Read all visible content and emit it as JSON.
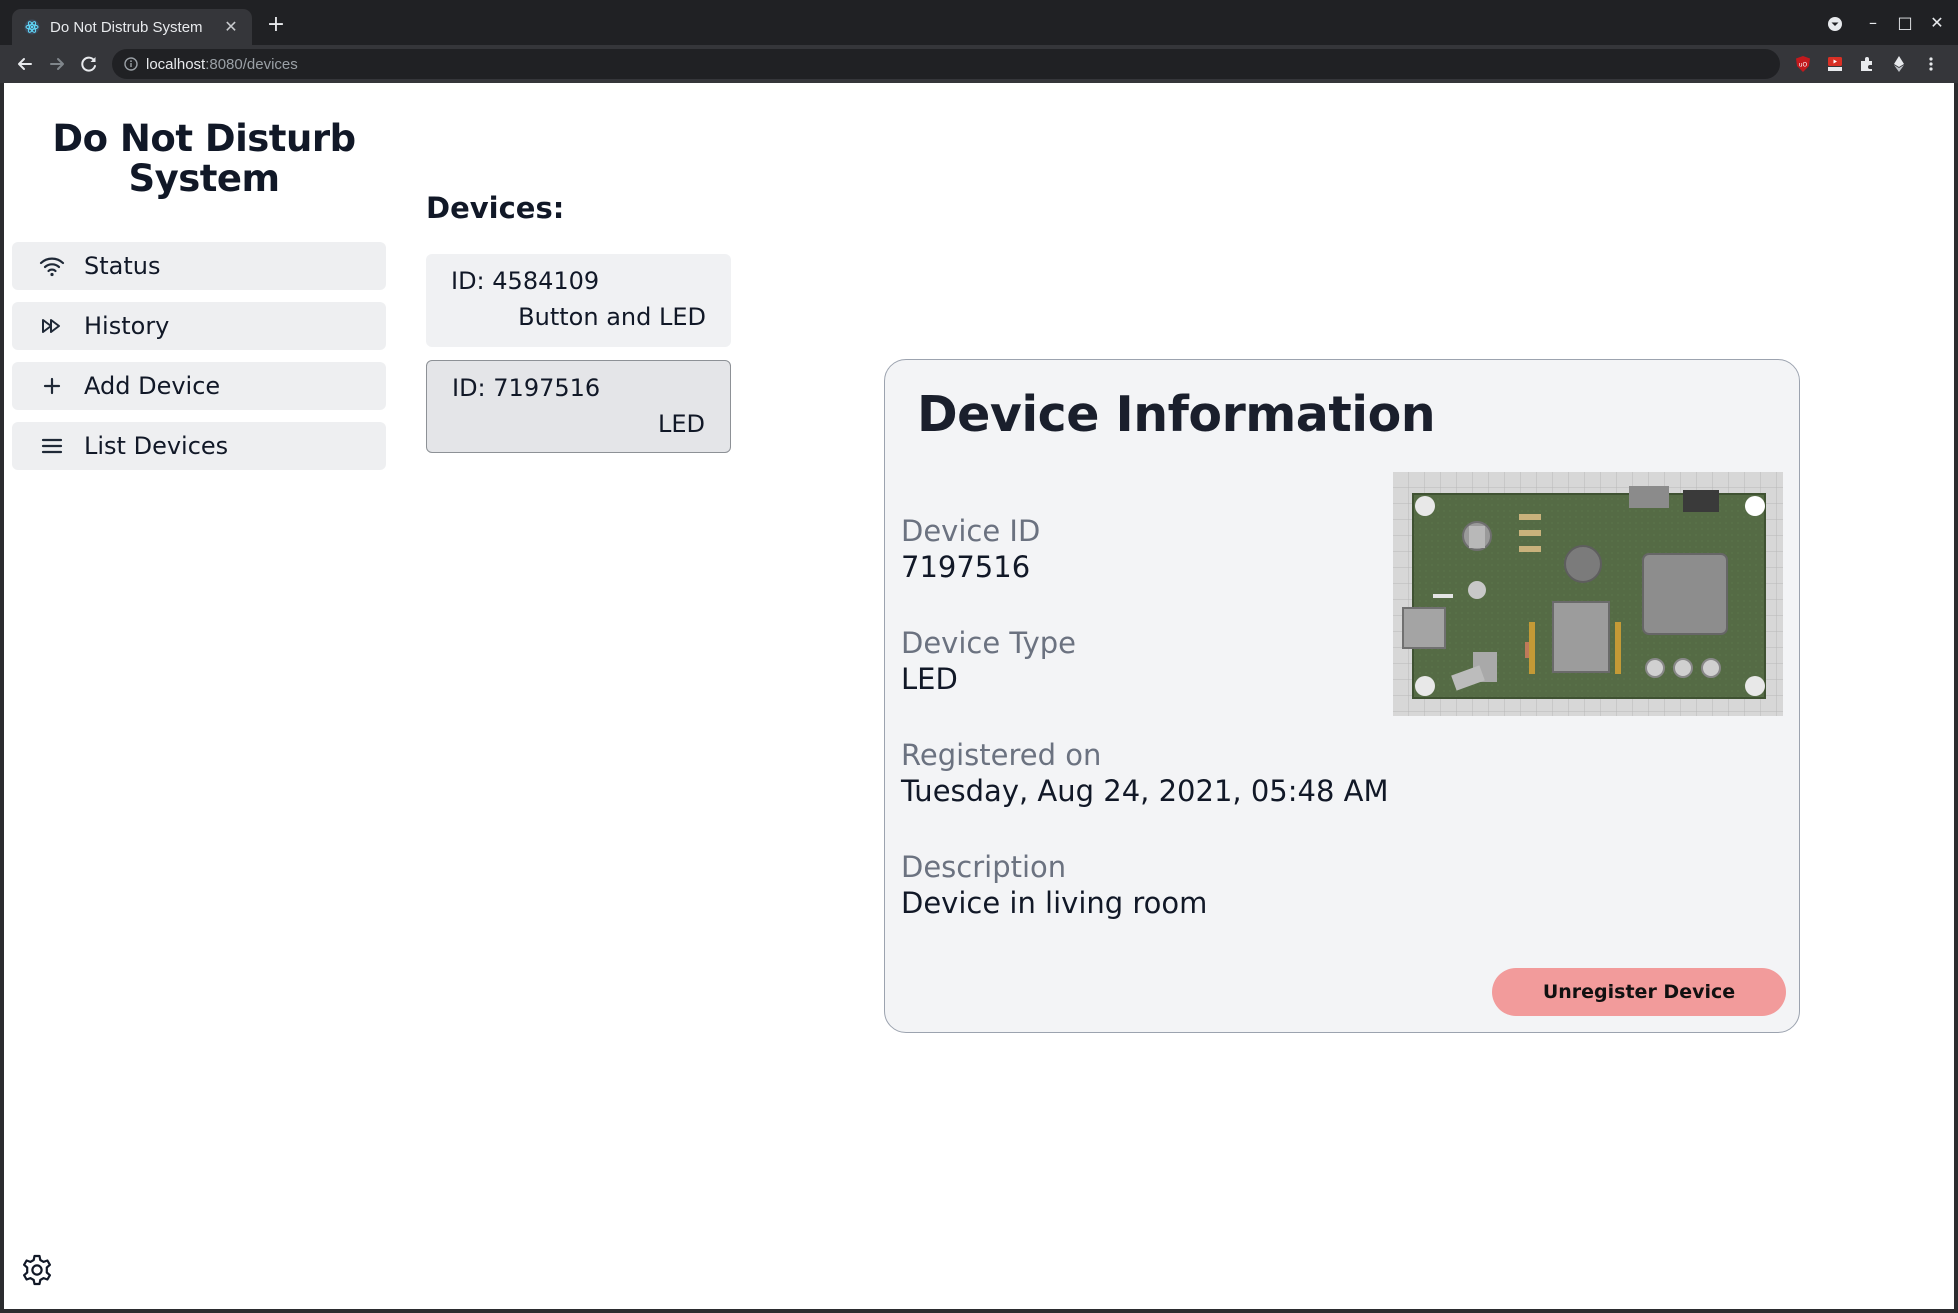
{
  "browser": {
    "tab_title": "Do Not Distrub System",
    "tab_close": "✕",
    "new_tab": "+",
    "url_host": "localhost",
    "url_path": ":8080/devices",
    "window_controls": {
      "minimize": "–",
      "maximize": "□",
      "close": "✕"
    }
  },
  "sidebar": {
    "title": "Do Not Disturb System",
    "items": [
      {
        "label": "Status",
        "icon": "wifi-icon"
      },
      {
        "label": "History",
        "icon": "fast-forward-icon"
      },
      {
        "label": "Add Device",
        "icon": "plus-icon"
      },
      {
        "label": "List Devices",
        "icon": "list-icon"
      }
    ]
  },
  "devices": {
    "heading": "Devices:",
    "list": [
      {
        "id": "ID: 4584109",
        "type": "Button and LED"
      },
      {
        "id": "ID: 7197516",
        "type": "LED",
        "selected": true
      }
    ]
  },
  "info": {
    "title": "Device Information",
    "fields": [
      {
        "label": "Device ID",
        "value": "7197516"
      },
      {
        "label": "Device Type",
        "value": "LED"
      },
      {
        "label": "Registered on",
        "value": "Tuesday, Aug 24, 2021, 05:48 AM"
      },
      {
        "label": "Description",
        "value": "Device in living room"
      }
    ],
    "unregister_label": "Unregister Device"
  },
  "colors": {
    "unregister_button": "#f29b9b",
    "nav_background": "#eeeff1",
    "panel_background": "#f3f4f6"
  }
}
